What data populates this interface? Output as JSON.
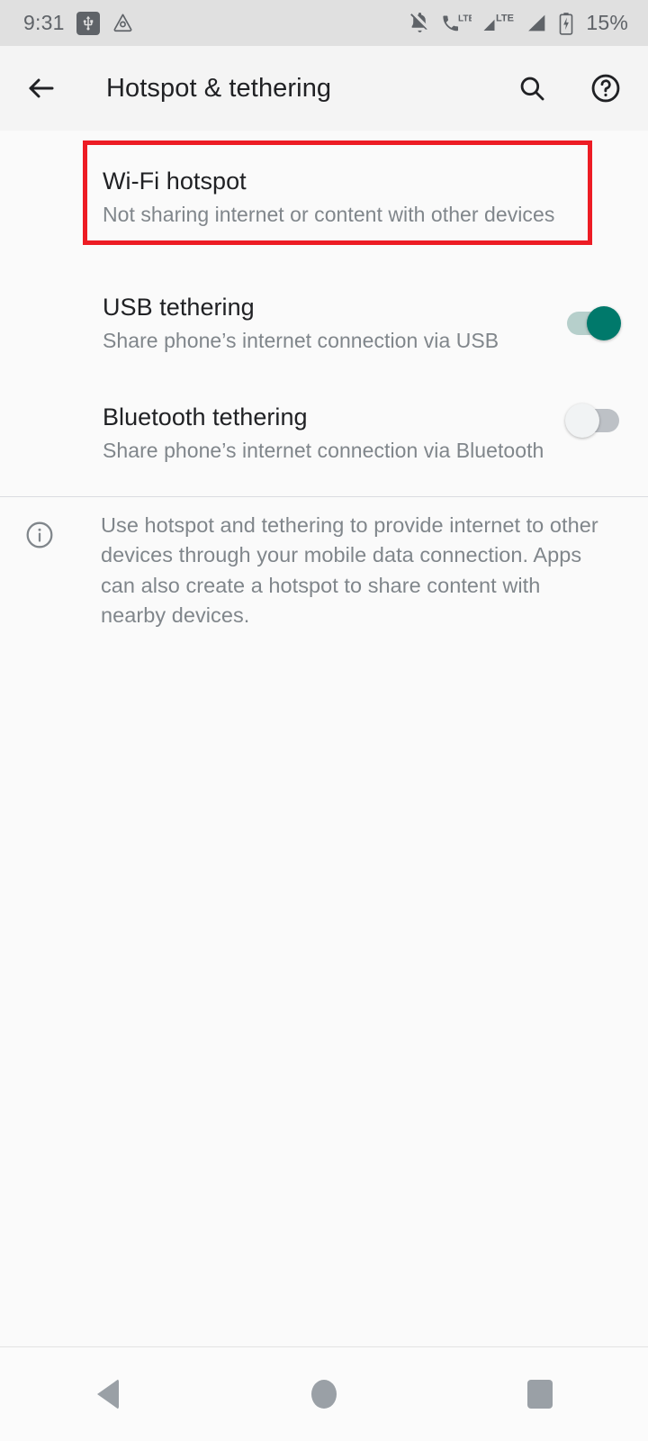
{
  "status_bar": {
    "time": "9:31",
    "battery_percent": "15%",
    "left_icons": [
      "usb-icon",
      "android-debug-icon"
    ],
    "right_icons": [
      "notifications-muted-icon",
      "phone-lte-icon",
      "signal-lte-icon",
      "signal-icon",
      "battery-charging-icon"
    ],
    "background_color": "#e0e0e0"
  },
  "app_bar": {
    "back_label": "back-arrow",
    "title": "Hotspot & tethering",
    "search_label": "search-icon",
    "help_label": "help-icon",
    "background_color": "#f4f4f4"
  },
  "preferences": [
    {
      "id": "wifi-hotspot",
      "title": "Wi-Fi hotspot",
      "summary": "Not sharing internet or content with other devices",
      "has_switch": false,
      "highlighted": true
    },
    {
      "id": "usb-tethering",
      "title": "USB tethering",
      "summary": "Share phone’s internet connection via USB",
      "has_switch": true,
      "switch_state": "on",
      "highlighted": false
    },
    {
      "id": "bluetooth-tethering",
      "title": "Bluetooth tethering",
      "summary": "Share phone’s internet connection via Bluetooth",
      "has_switch": true,
      "switch_state": "off",
      "highlighted": false
    }
  ],
  "footer": {
    "icon": "info-icon",
    "text": "Use hotspot and tethering to provide internet to other devices through your mobile data connection. Apps can also create a hotspot to share content with nearby devices."
  },
  "nav_bar": {
    "back": "navigation-back",
    "home": "navigation-home",
    "recents": "navigation-recents"
  },
  "colors": {
    "page_background": "#fafafa",
    "highlight_border": "#ed1c24",
    "switch_on_thumb": "#00796b",
    "switch_on_track": "#b6cfcb",
    "switch_off_thumb": "#f1f3f4",
    "switch_off_track": "#bdc1c6",
    "primary_text": "#202124",
    "secondary_text": "#80868b"
  }
}
